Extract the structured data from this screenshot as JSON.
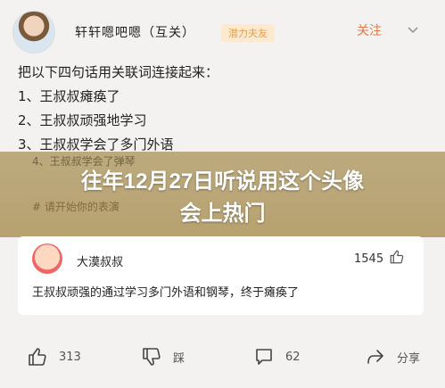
{
  "post": {
    "author": "轩轩嗯吧嗯（互关）",
    "badge": "潜力夫友",
    "follow_label": "关注"
  },
  "question": {
    "prompt": "把以下四句话用关联词连接起来：",
    "items": [
      "1、王叔叔瘫痪了",
      "2、王叔叔顽强地学习",
      "3、王叔叔学会了多门外语",
      "4、王叔叔学会了弹琴"
    ]
  },
  "overlay": {
    "title_line1": "往年12月27日听说用这个头像",
    "title_line2": "会上热门",
    "sub1": "4、王叔叔学会了弹琴",
    "sub2": "# 请开始你的表演"
  },
  "comment": {
    "name": "大漠叔叔",
    "likes": "1545",
    "text": "王叔叔顽强的通过学习多门外语和钢琴，终于瘫痪了"
  },
  "actions": [
    {
      "icon": "thumbs-up-icon",
      "count": "313"
    },
    {
      "icon": "thumbs-down-icon",
      "label": "踩"
    },
    {
      "icon": "comment-icon",
      "count": "62"
    },
    {
      "icon": "share-icon",
      "label": "分享"
    }
  ],
  "colors": {
    "follow": "#e07a4a",
    "badge_bg": "#fde9cf",
    "badge_fg": "#e7a04a",
    "overlay": "#b49f6e"
  }
}
